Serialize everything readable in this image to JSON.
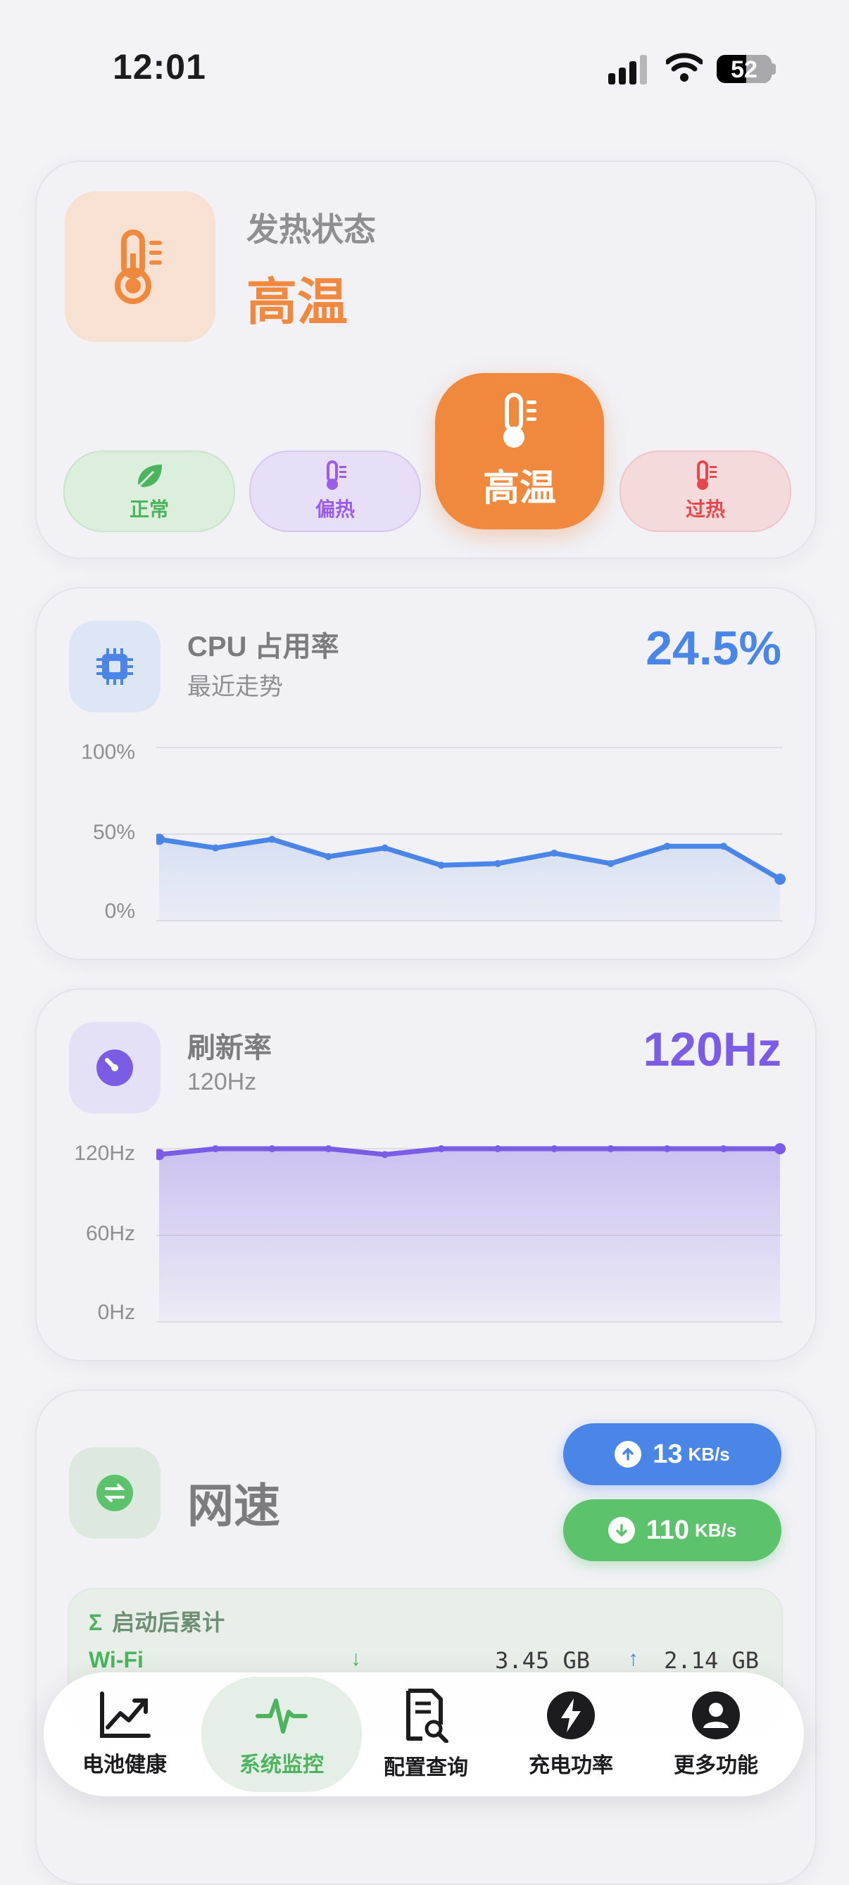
{
  "status_bar": {
    "time": "12:01",
    "battery": "52"
  },
  "heat": {
    "title": "发热状态",
    "value": "高温",
    "levels": [
      {
        "label": "正常",
        "icon": "leaf-icon",
        "color": "#4cb35e"
      },
      {
        "label": "偏热",
        "icon": "thermometer-icon",
        "color": "#9b5de5"
      },
      {
        "label": "高温",
        "icon": "thermometer-icon",
        "color": "#f0883e",
        "selected": true
      },
      {
        "label": "过热",
        "icon": "thermometer-icon",
        "color": "#e5484d"
      }
    ]
  },
  "cpu": {
    "title": "CPU 占用率",
    "subtitle": "最近走势",
    "value": "24.5%",
    "color": "#4a86e8",
    "chart_data": {
      "type": "area",
      "y_ticks": [
        "100%",
        "50%",
        "0%"
      ],
      "ylim": [
        0,
        100
      ],
      "values": [
        47,
        42,
        47,
        37,
        42,
        32,
        33,
        39,
        33,
        43,
        43,
        24
      ]
    }
  },
  "refresh": {
    "title": "刷新率",
    "subtitle": "120Hz",
    "value": "120Hz",
    "color": "#7b5de5",
    "chart_data": {
      "type": "area",
      "y_ticks": [
        "120Hz",
        "60Hz",
        "0Hz"
      ],
      "ylim": [
        0,
        120
      ],
      "values": [
        116,
        120,
        120,
        120,
        116,
        120,
        120,
        120,
        120,
        120,
        120,
        120
      ]
    }
  },
  "network": {
    "title": "网速",
    "upload": {
      "value": "13",
      "unit": "KB/s",
      "color": "#4a86e8"
    },
    "download": {
      "value": "110",
      "unit": "KB/s",
      "color": "#5cc26b"
    },
    "summary_title": "启动后累计",
    "rows": [
      {
        "name": "Wi-Fi",
        "down": "3.45 GB",
        "up": "2.14 GB"
      }
    ]
  },
  "tabs": [
    {
      "label": "电池健康",
      "icon": "chart-trend-icon"
    },
    {
      "label": "系统监控",
      "icon": "pulse-icon",
      "active": true
    },
    {
      "label": "配置查询",
      "icon": "document-search-icon"
    },
    {
      "label": "充电功率",
      "icon": "bolt-icon"
    },
    {
      "label": "更多功能",
      "icon": "person-icon"
    }
  ]
}
